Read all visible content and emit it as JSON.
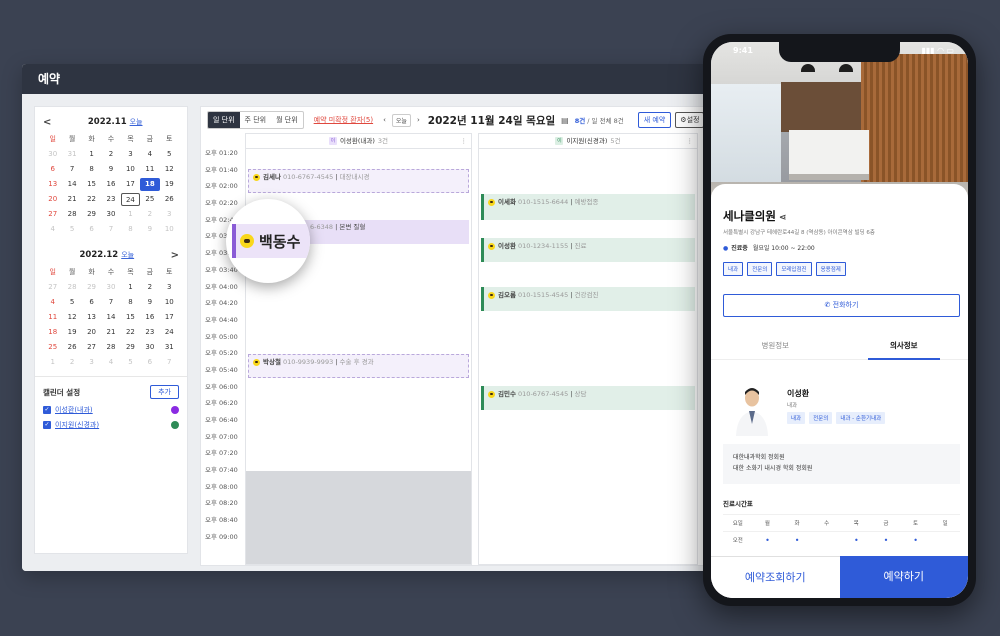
{
  "app": {
    "title": "예약"
  },
  "mini_cal_nov": {
    "month": "2022.11",
    "today": "오늘",
    "prev": "<",
    "dow": [
      "일",
      "월",
      "화",
      "수",
      "목",
      "금",
      "토"
    ],
    "days": [
      "30",
      "31",
      "1",
      "2",
      "3",
      "4",
      "5",
      "6",
      "7",
      "8",
      "9",
      "10",
      "11",
      "12",
      "13",
      "14",
      "15",
      "16",
      "17",
      "18",
      "19",
      "20",
      "21",
      "22",
      "23",
      "24",
      "25",
      "26",
      "27",
      "28",
      "29",
      "30",
      "1",
      "2",
      "3",
      "4",
      "5",
      "6",
      "7",
      "8",
      "9",
      "10"
    ]
  },
  "mini_cal_dec": {
    "month": "2022.12",
    "today": "오늘",
    "next": ">",
    "dow": [
      "일",
      "월",
      "화",
      "수",
      "목",
      "금",
      "토"
    ],
    "days": [
      "27",
      "28",
      "29",
      "30",
      "1",
      "2",
      "3",
      "4",
      "5",
      "6",
      "7",
      "8",
      "9",
      "10",
      "11",
      "12",
      "13",
      "14",
      "15",
      "16",
      "17",
      "18",
      "19",
      "20",
      "21",
      "22",
      "23",
      "24",
      "25",
      "26",
      "27",
      "28",
      "29",
      "30",
      "31",
      "1",
      "2",
      "3",
      "4",
      "5",
      "6",
      "7"
    ]
  },
  "calendar_settings": {
    "title": "캘린더 설정",
    "add": "추가",
    "items": [
      {
        "label": "이성환(내과)",
        "color": "#8a2be2"
      },
      {
        "label": "이지원(신경과)",
        "color": "#2e8b57"
      }
    ]
  },
  "toolbar": {
    "views": [
      "일 단위",
      "주 단위",
      "월 단위"
    ],
    "unconfirmed": "예약 미확정 환자(5)",
    "today": "오늘",
    "date": "2022년 11월 24일 목요일",
    "count_main": "8건",
    "count_rest": "/ 일 전체 8건",
    "new": "새 예약",
    "settings": "설정"
  },
  "times": [
    "오후 01:20",
    "오후 01:40",
    "오후 02:00",
    "오후 02:20",
    "오후 02:40",
    "오후 03:00",
    "오후 03:20",
    "오후 03:40",
    "오후 04:00",
    "오후 04:20",
    "오후 04:40",
    "오후 05:00",
    "오후 05:20",
    "오후 05:40",
    "오후 06:00",
    "오후 06:20",
    "오후 06:40",
    "오후 07:00",
    "오후 07:20",
    "오후 07:40",
    "오후 08:00",
    "오후 08:20",
    "오후 08:40",
    "오후 09:00"
  ],
  "columns": [
    {
      "badge": "이",
      "name": "이성환(내과)",
      "count": "3건",
      "badge_color": "#e9dffb",
      "badge_text": "#8a5cd6"
    },
    {
      "badge": "이",
      "name": "이지원(신경과)",
      "count": "5건",
      "badge_color": "#dcefe4",
      "badge_text": "#2e8b57"
    }
  ],
  "events_col1": [
    {
      "name": "김세나",
      "phone": "010-6767-4545",
      "memo": "대장내시경"
    },
    {
      "name": "",
      "phone": "6-6348",
      "memo": "본변 질혈"
    },
    {
      "name": "박상철",
      "phone": "010-9939-9993",
      "memo": "수술 후 경과"
    }
  ],
  "events_col2": [
    {
      "name": "이세화",
      "phone": "010-1515-6644",
      "memo": "예방접종"
    },
    {
      "name": "이성환",
      "phone": "010-1234-1155",
      "memo": "진료"
    },
    {
      "name": "김오롬",
      "phone": "010-1515-4545",
      "memo": "건강검진"
    },
    {
      "name": "김민수",
      "phone": "010-6767-4545",
      "memo": "상담"
    }
  ],
  "magnifier": {
    "name": "백동수"
  },
  "phone": {
    "time": "9:41",
    "clinic": "세나클의원",
    "address": "서울특별시 강남구 테헤란로44길 8 (역삼동) 아이콘역삼 빌딩 6층",
    "hours_label": "진료중",
    "hours": "월요일 10:00 ~ 22:00",
    "tags": [
      "내과",
      "전문의",
      "모레입점진",
      "응용점제"
    ],
    "call": "전화하기",
    "tabs": [
      "병원정보",
      "의사정보"
    ],
    "doctor": {
      "name": "이성환",
      "dept": "내과",
      "tags": [
        "내과",
        "전문의",
        "내과 - 순환기내과"
      ]
    },
    "career": [
      "대한내과학회 정회원",
      "대한 소화기 내시경 학회 정회원"
    ],
    "schedule_title": "진료시간표",
    "schedule_days": [
      "요일",
      "월",
      "화",
      "수",
      "목",
      "금",
      "토",
      "일"
    ],
    "schedule_am": "오전",
    "schedule_marks": [
      "•",
      "•",
      "",
      "•",
      "•",
      "•",
      ""
    ],
    "btn_lookup": "예약조회하기",
    "btn_book": "예약하기"
  }
}
